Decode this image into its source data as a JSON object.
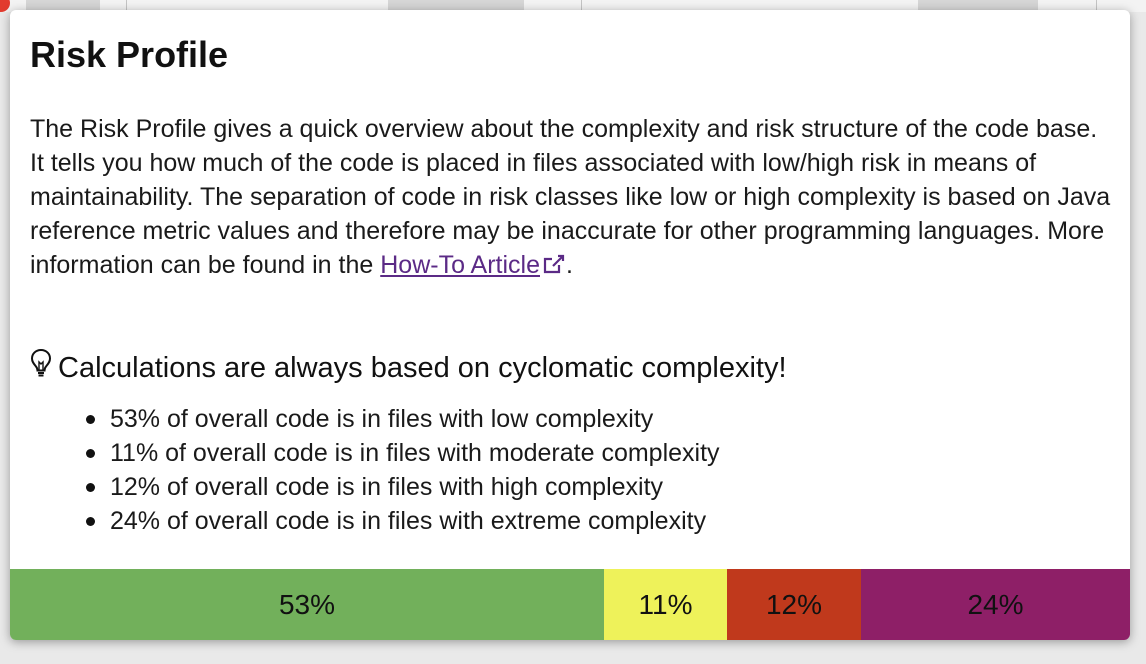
{
  "popover": {
    "title": "Risk Profile",
    "description": "The Risk Profile gives a quick overview about the complexity and risk structure of the code base. It tells you how much of the code is placed in files associated with low/high risk in means of maintainability. The separation of code in risk classes like low or high complexity is based on Java reference metric values and therefore may be inaccurate for other programming languages. More information can be found in the ",
    "link_text": "How-To Article",
    "description_end": ".",
    "calc_heading": "Calculations are always based on cyclomatic complexity!",
    "bullets": [
      "53% of overall code is in files with low complexity",
      "11% of overall code is in files with moderate complexity",
      "12% of overall code is in files with high complexity",
      "24% of overall code is in files with extreme complexity"
    ],
    "risk_bar": [
      {
        "label": "53%",
        "fraction": 0.53,
        "color": "#72b05b"
      },
      {
        "label": "11%",
        "fraction": 0.11,
        "color": "#eef25a"
      },
      {
        "label": "12%",
        "fraction": 0.12,
        "color": "#c0391c"
      },
      {
        "label": "24%",
        "fraction": 0.24,
        "color": "#8e1f67"
      }
    ]
  },
  "colors": {
    "link": "#5b2a86"
  },
  "icons": {
    "external_link": "external-link-icon",
    "lightbulb": "lightbulb-icon"
  }
}
